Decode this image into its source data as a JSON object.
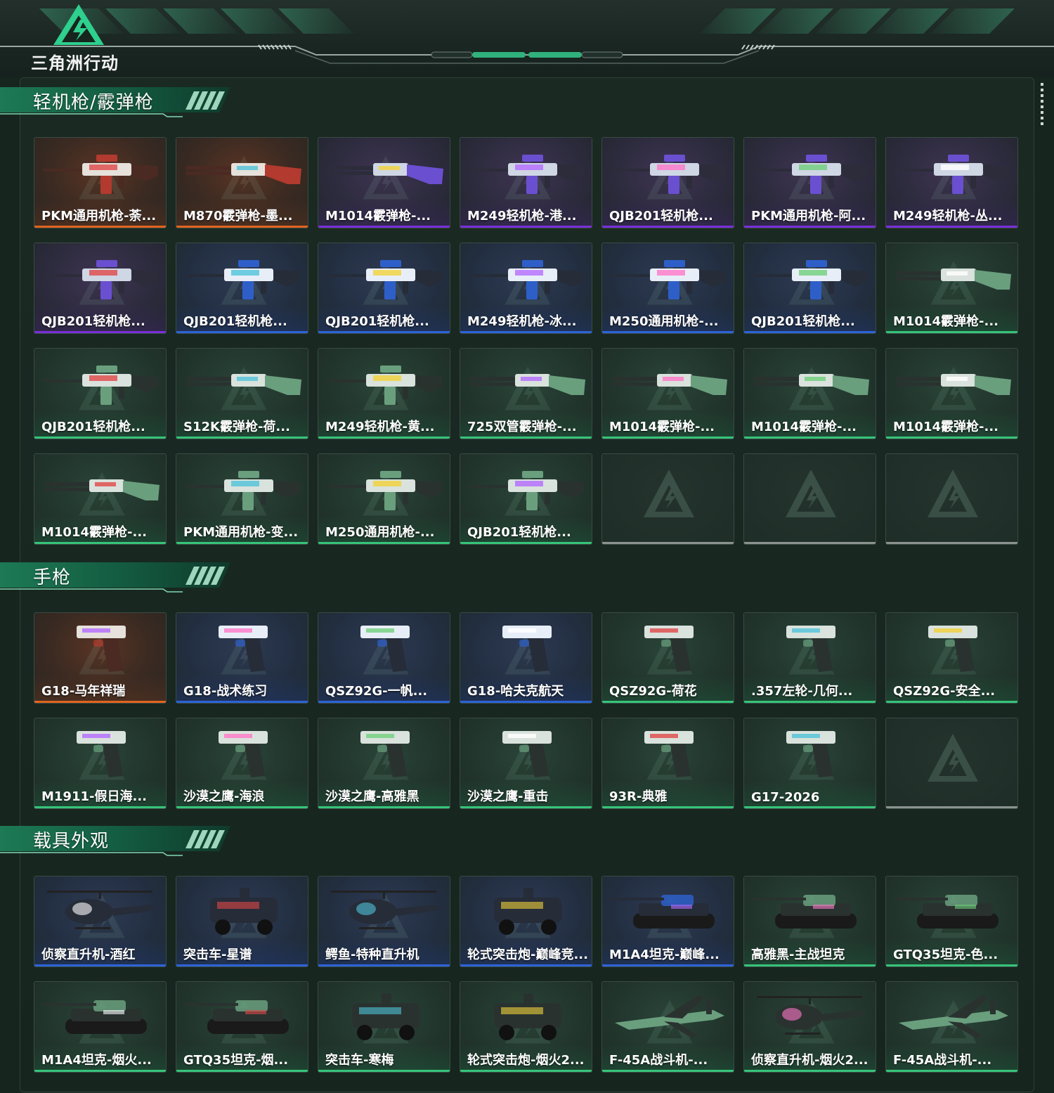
{
  "brand": {
    "logo_text": "三角洲行动"
  },
  "colors": {
    "orange": "#e0641f",
    "purple": "#7a2fd9",
    "blue": "#2d63d8",
    "green": "#36c47a",
    "gray": "#8a9390"
  },
  "sections": [
    {
      "title": "轻机枪/霰弹枪",
      "items": [
        {
          "label": "PKM通用机枪-荼...",
          "rarity": "orange",
          "icon": "machine-gun-icon"
        },
        {
          "label": "M870霰弹枪-墨...",
          "rarity": "orange",
          "icon": "shotgun-icon"
        },
        {
          "label": "M1014霰弹枪-...",
          "rarity": "purple",
          "icon": "shotgun-icon"
        },
        {
          "label": "M249轻机枪-港...",
          "rarity": "purple",
          "icon": "machine-gun-icon"
        },
        {
          "label": "QJB201轻机枪...",
          "rarity": "purple",
          "icon": "machine-gun-icon"
        },
        {
          "label": "PKM通用机枪-阿...",
          "rarity": "purple",
          "icon": "machine-gun-icon"
        },
        {
          "label": "M249轻机枪-丛...",
          "rarity": "purple",
          "icon": "machine-gun-icon"
        },
        {
          "label": "QJB201轻机枪...",
          "rarity": "purple",
          "icon": "machine-gun-icon"
        },
        {
          "label": "QJB201轻机枪...",
          "rarity": "blue",
          "icon": "machine-gun-icon"
        },
        {
          "label": "QJB201轻机枪...",
          "rarity": "blue",
          "icon": "machine-gun-icon"
        },
        {
          "label": "M249轻机枪-冰...",
          "rarity": "blue",
          "icon": "machine-gun-icon"
        },
        {
          "label": "M250通用机枪-...",
          "rarity": "blue",
          "icon": "machine-gun-icon"
        },
        {
          "label": "QJB201轻机枪...",
          "rarity": "blue",
          "icon": "machine-gun-icon"
        },
        {
          "label": "M1014霰弹枪-...",
          "rarity": "green",
          "icon": "shotgun-icon"
        },
        {
          "label": "QJB201轻机枪...",
          "rarity": "green",
          "icon": "machine-gun-icon"
        },
        {
          "label": "S12K霰弹枪-荷...",
          "rarity": "green",
          "icon": "shotgun-icon"
        },
        {
          "label": "M249轻机枪-黄...",
          "rarity": "green",
          "icon": "machine-gun-icon"
        },
        {
          "label": "725双管霰弹枪-...",
          "rarity": "green",
          "icon": "shotgun-icon"
        },
        {
          "label": "M1014霰弹枪-...",
          "rarity": "green",
          "icon": "shotgun-icon"
        },
        {
          "label": "M1014霰弹枪-...",
          "rarity": "green",
          "icon": "shotgun-icon"
        },
        {
          "label": "M1014霰弹枪-...",
          "rarity": "green",
          "icon": "shotgun-icon"
        },
        {
          "label": "M1014霰弹枪-...",
          "rarity": "green",
          "icon": "shotgun-icon"
        },
        {
          "label": "PKM通用机枪-变...",
          "rarity": "green",
          "icon": "machine-gun-icon"
        },
        {
          "label": "M250通用机枪-...",
          "rarity": "green",
          "icon": "machine-gun-icon"
        },
        {
          "label": "QJB201轻机枪...",
          "rarity": "green",
          "icon": "machine-gun-icon"
        },
        {
          "label": "",
          "rarity": "gray",
          "icon": "empty-slot-icon"
        },
        {
          "label": "",
          "rarity": "gray",
          "icon": "empty-slot-icon"
        },
        {
          "label": "",
          "rarity": "gray",
          "icon": "empty-slot-icon"
        }
      ]
    },
    {
      "title": "手枪",
      "items": [
        {
          "label": "G18-马年祥瑞",
          "rarity": "orange",
          "icon": "pistol-icon"
        },
        {
          "label": "G18-战术练习",
          "rarity": "blue",
          "icon": "pistol-icon"
        },
        {
          "label": "QSZ92G-一帆...",
          "rarity": "blue",
          "icon": "pistol-icon"
        },
        {
          "label": "G18-哈夫克航天",
          "rarity": "blue",
          "icon": "pistol-icon"
        },
        {
          "label": "QSZ92G-荷花",
          "rarity": "green",
          "icon": "pistol-icon"
        },
        {
          "label": ".357左轮-几何...",
          "rarity": "green",
          "icon": "revolver-icon"
        },
        {
          "label": "QSZ92G-安全...",
          "rarity": "green",
          "icon": "pistol-icon"
        },
        {
          "label": "M1911-假日海...",
          "rarity": "green",
          "icon": "pistol-icon"
        },
        {
          "label": "沙漠之鹰-海浪",
          "rarity": "green",
          "icon": "pistol-icon"
        },
        {
          "label": "沙漠之鹰-高雅黑",
          "rarity": "green",
          "icon": "pistol-icon"
        },
        {
          "label": "沙漠之鹰-重击",
          "rarity": "green",
          "icon": "pistol-icon"
        },
        {
          "label": "93R-典雅",
          "rarity": "green",
          "icon": "pistol-icon"
        },
        {
          "label": "G17-2026",
          "rarity": "green",
          "icon": "pistol-icon"
        },
        {
          "label": "",
          "rarity": "gray",
          "icon": "empty-slot-icon"
        }
      ]
    },
    {
      "title": "载具外观",
      "items": [
        {
          "label": "侦察直升机-酒红",
          "rarity": "blue",
          "icon": "helicopter-icon"
        },
        {
          "label": "突击车-星谱",
          "rarity": "blue",
          "icon": "armored-car-icon"
        },
        {
          "label": "鳄鱼-特种直升机",
          "rarity": "blue",
          "icon": "helicopter-icon"
        },
        {
          "label": "轮式突击炮-巅峰竞...",
          "rarity": "blue",
          "icon": "armored-car-icon"
        },
        {
          "label": "M1A4坦克-巅峰...",
          "rarity": "blue",
          "icon": "tank-icon"
        },
        {
          "label": "高雅黑-主战坦克",
          "rarity": "green",
          "icon": "tank-icon"
        },
        {
          "label": "GTQ35坦克-色...",
          "rarity": "green",
          "icon": "tank-icon"
        },
        {
          "label": "M1A4坦克-烟火...",
          "rarity": "green",
          "icon": "tank-icon"
        },
        {
          "label": "GTQ35坦克-烟...",
          "rarity": "green",
          "icon": "tank-icon"
        },
        {
          "label": "突击车-寒梅",
          "rarity": "green",
          "icon": "armored-car-icon"
        },
        {
          "label": "轮式突击炮-烟火2...",
          "rarity": "green",
          "icon": "armored-car-icon"
        },
        {
          "label": "F-45A战斗机-...",
          "rarity": "green",
          "icon": "jet-icon"
        },
        {
          "label": "侦察直升机-烟火2...",
          "rarity": "green",
          "icon": "helicopter-icon"
        },
        {
          "label": "F-45A战斗机-...",
          "rarity": "green",
          "icon": "jet-icon"
        }
      ]
    }
  ]
}
